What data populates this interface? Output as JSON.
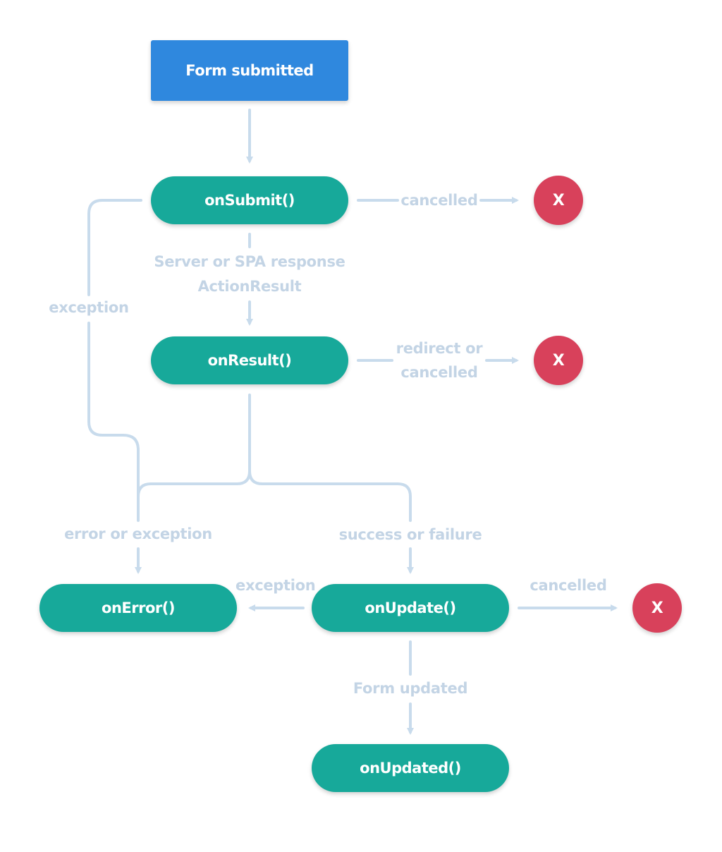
{
  "colors": {
    "start": "#2f88de",
    "step": "#17a99a",
    "end": "#d8415b",
    "connector": "#c8dbec",
    "label": "#c3d4e5"
  },
  "nodes": {
    "form_submitted": "Form submitted",
    "on_submit": "onSubmit()",
    "on_result": "onResult()",
    "on_error": "onError()",
    "on_update": "onUpdate()",
    "on_updated": "onUpdated()",
    "end_marker": "X"
  },
  "edge_labels": {
    "submit_cancelled": "cancelled",
    "submit_exception": "exception",
    "response_line1": "Server or SPA response",
    "response_line2": "ActionResult",
    "result_redirect_line1": "redirect or",
    "result_redirect_line2": "cancelled",
    "error_or_exception": "error or exception",
    "success_or_failure": "success or failure",
    "update_exception": "exception",
    "update_cancelled": "cancelled",
    "form_updated": "Form updated"
  }
}
